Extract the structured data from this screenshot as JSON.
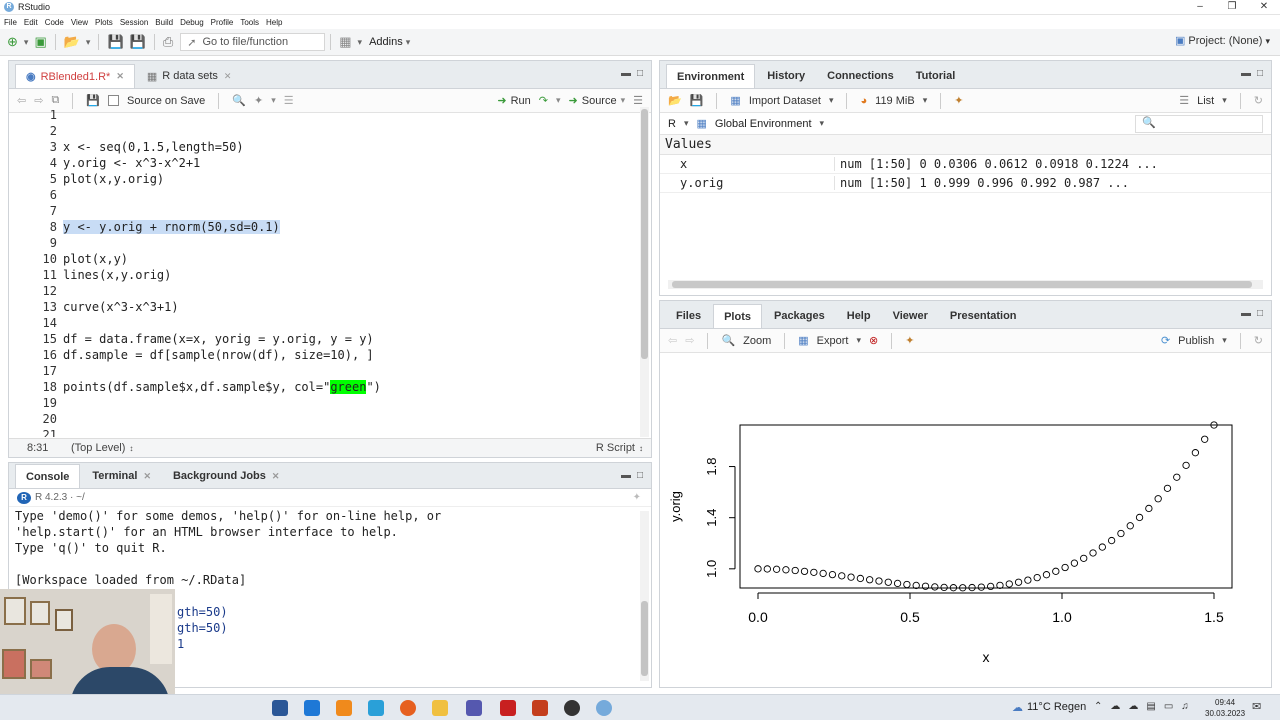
{
  "window": {
    "title": "RStudio"
  },
  "menu": [
    "File",
    "Edit",
    "Code",
    "View",
    "Plots",
    "Session",
    "Build",
    "Debug",
    "Profile",
    "Tools",
    "Help"
  ],
  "toolbar": {
    "goto_placeholder": "Go to file/function",
    "addins": "Addins",
    "project": "Project: (None)"
  },
  "editor": {
    "tabs": [
      {
        "label": "RBlended1.R*"
      },
      {
        "label": "R data sets"
      }
    ],
    "source_on_save": "Source on Save",
    "run": "Run",
    "source": "Source",
    "lines": [
      {
        "n": "1",
        "code": ""
      },
      {
        "n": "2",
        "code": ""
      },
      {
        "n": "3",
        "code": "x <- seq(0,1.5,length=50)"
      },
      {
        "n": "4",
        "code": "y.orig <- x^3-x^2+1"
      },
      {
        "n": "5",
        "code": "plot(x,y.orig)"
      },
      {
        "n": "6",
        "code": ""
      },
      {
        "n": "7",
        "code": ""
      },
      {
        "n": "8",
        "code": "y <- y.orig + rnorm(50,sd=0.1)"
      },
      {
        "n": "9",
        "code": ""
      },
      {
        "n": "10",
        "code": "plot(x,y)"
      },
      {
        "n": "11",
        "code": "lines(x,y.orig)"
      },
      {
        "n": "12",
        "code": ""
      },
      {
        "n": "13",
        "code": "curve(x^3-x^3+1)"
      },
      {
        "n": "14",
        "code": ""
      },
      {
        "n": "15",
        "code": "df = data.frame(x=x, yorig = y.orig, y = y)"
      },
      {
        "n": "16",
        "code": "df.sample = df[sample(nrow(df), size=10), ]"
      },
      {
        "n": "17",
        "code": ""
      },
      {
        "n": "18",
        "code_a": "points(df.sample$x,df.sample$y, col=\"",
        "code_b": "green",
        "code_c": "\")"
      },
      {
        "n": "19",
        "code": ""
      },
      {
        "n": "20",
        "code": ""
      },
      {
        "n": "21",
        "code": ""
      }
    ],
    "status_pos": "8:31",
    "status_scope": "(Top Level)",
    "status_type": "R Script"
  },
  "console": {
    "tabs": [
      {
        "label": "Console"
      },
      {
        "label": "Terminal"
      },
      {
        "label": "Background Jobs"
      }
    ],
    "version": "R 4.2.3 · ~/",
    "lines": [
      "Type 'demo()' for some demos, 'help()' for on-line help, or",
      "'help.start()' for an HTML browser interface to help.",
      "Type 'q()' to quit R.",
      "",
      "[Workspace loaded from ~/.RData]",
      "",
      "gth=50)",
      "gth=50)",
      "1"
    ]
  },
  "environment": {
    "tabs": [
      {
        "label": "Environment"
      },
      {
        "label": "History"
      },
      {
        "label": "Connections"
      },
      {
        "label": "Tutorial"
      }
    ],
    "import": "Import Dataset",
    "memory": "119 MiB",
    "list": "List",
    "lang": "R",
    "scope": "Global Environment",
    "section": "Values",
    "values": [
      {
        "name": "x",
        "value": "num [1:50] 0 0.0306 0.0612 0.0918 0.1224 ..."
      },
      {
        "name": "y.orig",
        "value": "num [1:50] 1 0.999 0.996 0.992 0.987 ..."
      }
    ]
  },
  "plots_pane": {
    "tabs": [
      {
        "label": "Files"
      },
      {
        "label": "Plots"
      },
      {
        "label": "Packages"
      },
      {
        "label": "Help"
      },
      {
        "label": "Viewer"
      },
      {
        "label": "Presentation"
      }
    ],
    "zoom": "Zoom",
    "export": "Export",
    "publish": "Publish"
  },
  "chart_data": {
    "type": "scatter",
    "xlabel": "x",
    "ylabel": "y.orig",
    "xlim": [
      0,
      1.5
    ],
    "ylim": [
      0.85,
      2.125
    ],
    "xticks": [
      "0.0",
      "0.5",
      "1.0",
      "1.5"
    ],
    "yticks": [
      "1.0",
      "1.4",
      "1.8"
    ],
    "n": 50,
    "formula": "y = x^3 - x^2 + 1, x = seq(0,1.5,length=50)"
  },
  "taskbar": {
    "weather": "11°C Regen",
    "time": "09:44",
    "date": "30.03.2023"
  }
}
